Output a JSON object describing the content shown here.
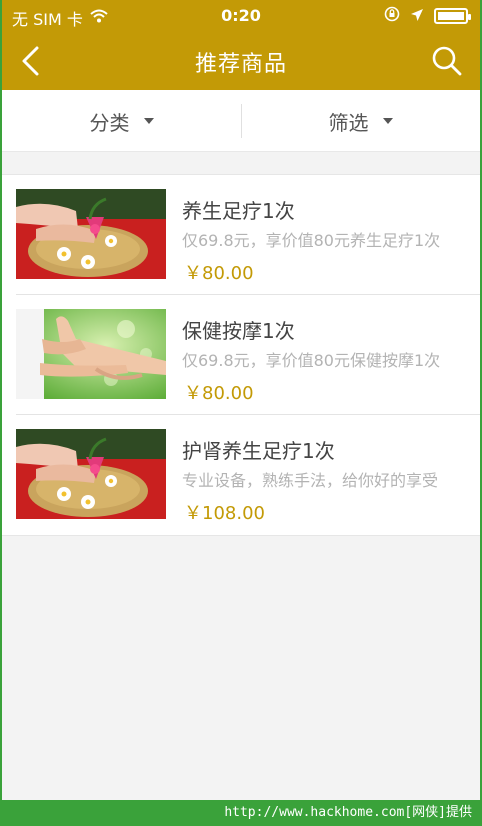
{
  "status": {
    "carrier": "无 SIM 卡",
    "time": "0:20"
  },
  "nav": {
    "title": "推荐商品"
  },
  "filters": {
    "category_label": "分类",
    "filter_label": "筛选"
  },
  "products": [
    {
      "name": "养生足疗1次",
      "desc": "仅69.8元，享价值80元养生足疗1次",
      "price": "￥80.00",
      "image": "foot-bath"
    },
    {
      "name": "保健按摩1次",
      "desc": "仅69.8元，享价值80元保健按摩1次",
      "price": "￥80.00",
      "image": "foot-massage"
    },
    {
      "name": "护肾养生足疗1次",
      "desc": "专业设备，熟练手法，给你好的享受",
      "price": "￥108.00",
      "image": "foot-bath"
    }
  ],
  "watermark": {
    "text": "http://www.hackhome.com[网侠]提供"
  },
  "colors": {
    "brand": "#c39a06",
    "frame": "#3aa23a"
  }
}
